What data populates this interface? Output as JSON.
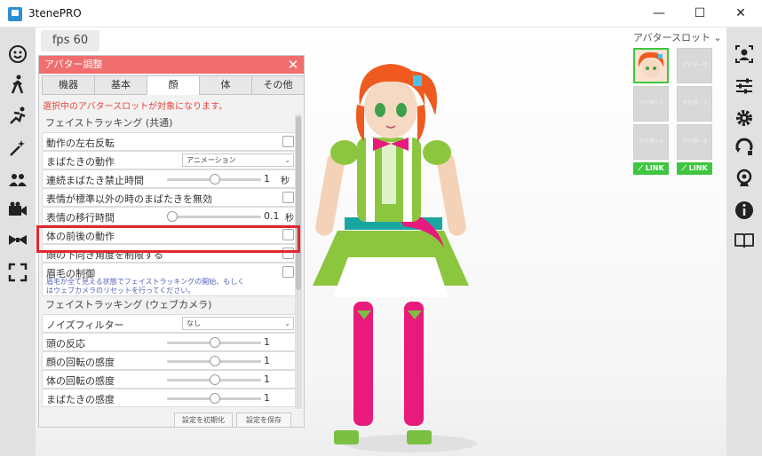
{
  "window": {
    "title": "3tenePRO",
    "minimize": "—",
    "maximize": "☐",
    "close": "✕"
  },
  "fps": "fps 60",
  "panel": {
    "title": "アバター調整",
    "tabs": [
      "機器",
      "基本",
      "顔",
      "体",
      "その他"
    ],
    "notice": "選択中のアバタースロットが対象になります。",
    "section1": "フェイストラッキング (共通)",
    "rows1": {
      "mirror": "動作の左右反転",
      "blink_motion": "まばたきの動作",
      "blink_motion_value": "アニメーション",
      "blink_disable_time": "連続まばたき禁止時間",
      "blink_disable_value": "1",
      "blink_disable_unit": "秒",
      "blink_invalid": "表情が標準以外の時のまばたきを無効",
      "expr_transition": "表情の移行時間",
      "expr_transition_value": "0.1",
      "expr_transition_unit": "秒",
      "body_forward": "体の前後の動作",
      "head_down_limit": "頭の下向き角度を制限する",
      "brow_control": "眉毛の制御",
      "brow_desc": "眉毛が全て見える状態でフェイストラッキングの開始、もしくはウェブカメラのリセットを行ってください。"
    },
    "section2": "フェイストラッキング (ウェブカメラ)",
    "rows2": {
      "noise_filter": "ノイズフィルター",
      "noise_filter_value": "なし",
      "head_react": "頭の反応",
      "head_react_value": "1",
      "face_rot": "顔の回転の感度",
      "face_rot_value": "1",
      "body_rot": "体の回転の感度",
      "body_rot_value": "1",
      "blink_sens": "まばたきの感度",
      "blink_sens_value": "1"
    },
    "buttons": {
      "reset": "設定を初期化",
      "save": "設定を保存"
    }
  },
  "slots": {
    "title": "アバタースロット",
    "labels": [
      "アバター0",
      "アバター1",
      "アバター3",
      "アバター1",
      "アバター2"
    ],
    "link": "LINK"
  }
}
